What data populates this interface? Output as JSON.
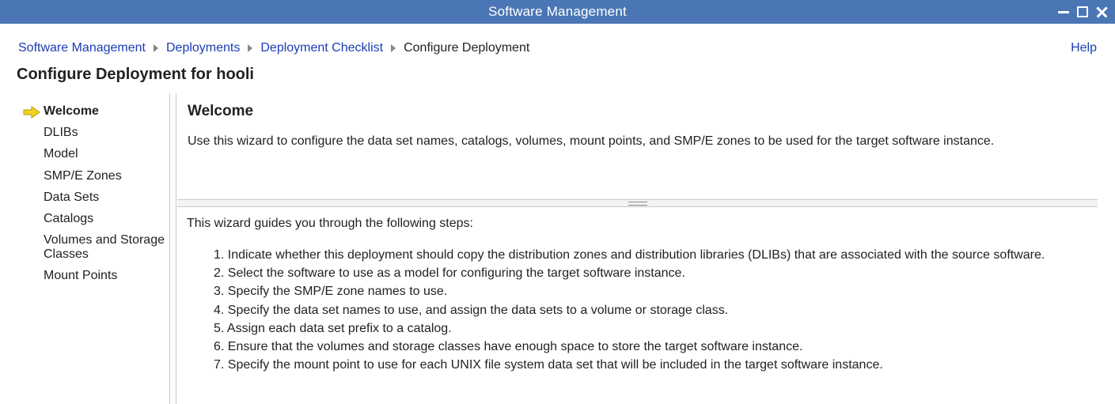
{
  "window": {
    "title": "Software Management",
    "controls": [
      "minimize-icon",
      "maximize-icon",
      "close-icon"
    ]
  },
  "breadcrumb": {
    "items": [
      "Software Management",
      "Deployments",
      "Deployment Checklist"
    ],
    "current": "Configure Deployment"
  },
  "help_label": "Help",
  "page_title": "Configure Deployment for hooli",
  "steps_nav": {
    "active_icon": "arrow-right-icon",
    "items": [
      "Welcome",
      "DLIBs",
      "Model",
      "SMP/E Zones",
      "Data Sets",
      "Catalogs",
      "Volumes and Storage Classes",
      "Mount Points"
    ]
  },
  "welcome": {
    "heading": "Welcome",
    "description": "Use this wizard to configure the data set names, catalogs, volumes, mount points, and SMP/E zones to be used for the target software instance."
  },
  "guide": {
    "intro": "This wizard guides you through the following steps:",
    "steps": [
      "1. Indicate whether this deployment should copy the distribution zones and distribution libraries (DLIBs) that are associated with the source software.",
      "2. Select the software to use as a model for configuring the target software instance.",
      "3. Specify the SMP/E zone names to use.",
      "4. Specify the data set names to use, and assign the data sets to a volume or storage class.",
      "5. Assign each data set prefix to a catalog.",
      "6. Ensure that the volumes and storage classes have enough space to store the target software instance.",
      "7. Specify the mount point to use for each UNIX file system data set that will be included in the target software instance."
    ]
  },
  "colors": {
    "titlebar": "#4a76b5",
    "link": "#1a3db5",
    "arrow": "#f2d21f"
  }
}
